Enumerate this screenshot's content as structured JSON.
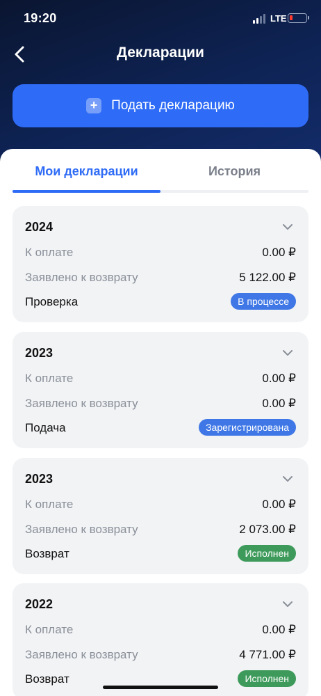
{
  "status_bar": {
    "time": "19:20",
    "network": "LTE"
  },
  "header": {
    "title": "Декларации",
    "back_icon": "chevron-left-icon"
  },
  "submit_button": {
    "label": "Подать декларацию",
    "icon": "plus-icon"
  },
  "tabs": [
    {
      "label": "Мои декларации",
      "active": true
    },
    {
      "label": "История",
      "active": false
    }
  ],
  "labels": {
    "to_pay": "К оплате",
    "claimed_refund": "Заявлено к возврату"
  },
  "declarations": [
    {
      "year": "2024",
      "to_pay": "0.00 ₽",
      "claimed_refund": "5 122.00 ₽",
      "stage": "Проверка",
      "status": "В процессе",
      "status_color": "#3f78e6"
    },
    {
      "year": "2023",
      "to_pay": "0.00 ₽",
      "claimed_refund": "0.00 ₽",
      "stage": "Подача",
      "status": "Зарегистрирована",
      "status_color": "#3f78e6"
    },
    {
      "year": "2023",
      "to_pay": "0.00 ₽",
      "claimed_refund": "2 073.00 ₽",
      "stage": "Возврат",
      "status": "Исполнен",
      "status_color": "#3d9a5a"
    },
    {
      "year": "2022",
      "to_pay": "0.00 ₽",
      "claimed_refund": "4 771.00 ₽",
      "stage": "Возврат",
      "status": "Исполнен",
      "status_color": "#3d9a5a"
    }
  ],
  "colors": {
    "accent": "#2e6bf6",
    "header_bg": "#0e2354",
    "card_bg": "#f2f3f5"
  }
}
